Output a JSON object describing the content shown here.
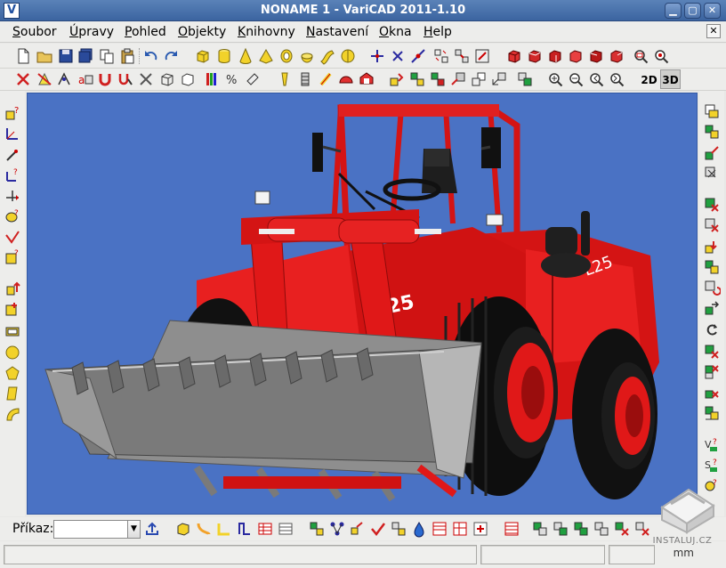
{
  "window": {
    "title": "NONAME 1 - VariCAD 2011-1.10",
    "controls": [
      "minimize-icon",
      "maximize-icon",
      "close-icon"
    ]
  },
  "menu": {
    "items": [
      "Soubor",
      "Úpravy",
      "Pohled",
      "Objekty",
      "Knihovny",
      "Nastavení",
      "Okna",
      "Help"
    ],
    "mdi_close": "✕"
  },
  "toolbar": {
    "view_2d": "2D",
    "view_3d": "3D",
    "active_view": "3D"
  },
  "command": {
    "label": "Příkaz:",
    "value": "",
    "dropdown_arrow": "▼"
  },
  "status": {
    "units": "mm"
  },
  "watermark": {
    "text": "INSTALUJ.CZ"
  },
  "colors": {
    "viewport_bg": "#4a72c4",
    "model_red": "#e01818",
    "bucket_gray": "#8e8e8e",
    "tire_black": "#111111",
    "titlebar": "#3b64a0"
  }
}
